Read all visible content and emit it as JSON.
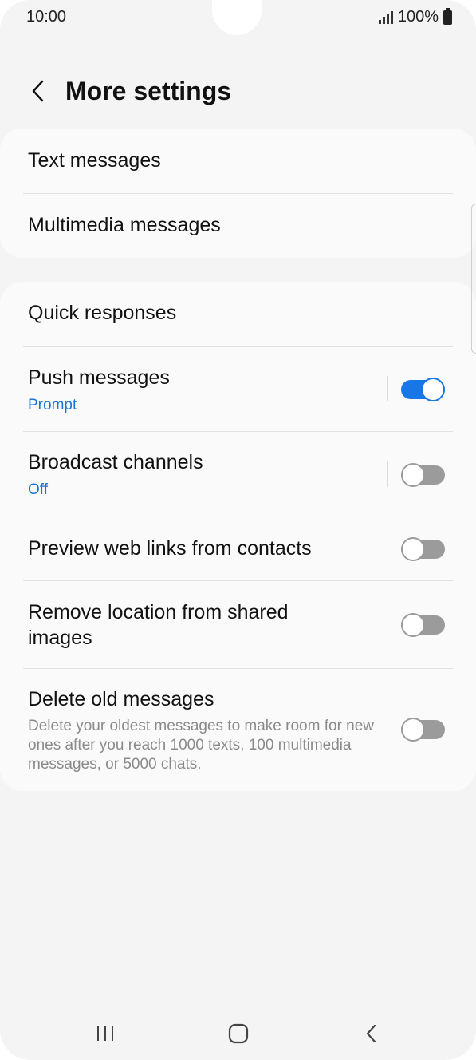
{
  "status_bar": {
    "time": "10:00",
    "battery_text": "100%"
  },
  "header": {
    "title": "More settings"
  },
  "card1": {
    "items": [
      {
        "label": "Text messages"
      },
      {
        "label": "Multimedia messages"
      }
    ]
  },
  "card2": {
    "quick_responses": {
      "label": "Quick responses"
    },
    "push_messages": {
      "label": "Push messages",
      "sub": "Prompt",
      "toggle_on": true
    },
    "broadcast_channels": {
      "label": "Broadcast channels",
      "sub": "Off",
      "toggle_on": false
    },
    "preview_links": {
      "label": "Preview web links from contacts",
      "toggle_on": false
    },
    "remove_location": {
      "label": "Remove location from shared images",
      "toggle_on": false
    },
    "delete_old": {
      "label": "Delete old messages",
      "desc": "Delete your oldest messages to make room for new ones after you reach 1000 texts, 100 multimedia messages, or 5000 chats.",
      "toggle_on": false
    }
  },
  "colors": {
    "accent": "#1877e8",
    "subtext": "#1a73d8",
    "toggle_off": "#9b9b9b"
  },
  "nav_bar": {
    "icons": [
      "recents-icon",
      "home-icon",
      "back-icon"
    ]
  }
}
